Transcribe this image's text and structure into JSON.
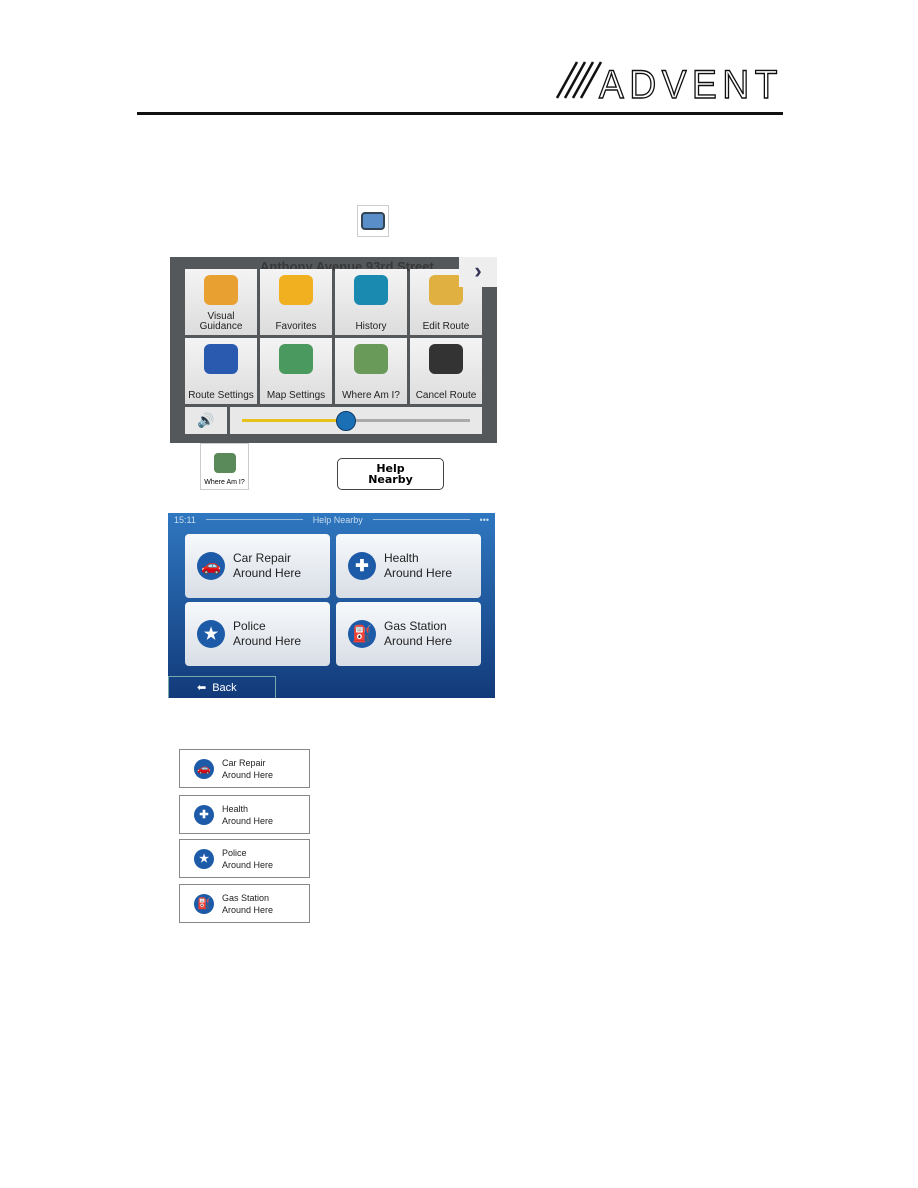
{
  "header": {
    "brand": "ADVENT"
  },
  "menu_screen": {
    "street": "Anthony Avenue 93rd Street",
    "items": [
      {
        "label": "Visual Guidance",
        "icon": "visual-guidance-icon",
        "color": "#e8a030"
      },
      {
        "label": "Favorites",
        "icon": "star-icon",
        "color": "#f0b020"
      },
      {
        "label": "History",
        "icon": "history-icon",
        "color": "#1a8ab0"
      },
      {
        "label": "Edit Route",
        "icon": "edit-route-icon",
        "color": "#e0b040"
      },
      {
        "label": "Route Settings",
        "icon": "route-settings-icon",
        "color": "#2a5ab0"
      },
      {
        "label": "Map Settings",
        "icon": "eye-icon",
        "color": "#4a9a60"
      },
      {
        "label": "Where Am I?",
        "icon": "where-am-i-icon",
        "color": "#6a9a5a"
      },
      {
        "label": "Cancel Route",
        "icon": "checkered-flag-icon",
        "color": "#333333"
      }
    ],
    "volume_percent": 45
  },
  "where_am_i_icon_label": "Where Am I?",
  "help_nearby_button": "Help Nearby",
  "help_screen": {
    "time": "15:11",
    "title": "Help Nearby",
    "back": "Back",
    "items": [
      {
        "line1": "Car Repair",
        "line2": "Around Here",
        "glyph": "🚗"
      },
      {
        "line1": "Health",
        "line2": "Around Here",
        "glyph": "✚"
      },
      {
        "line1": "Police",
        "line2": "Around Here",
        "glyph": "★"
      },
      {
        "line1": "Gas Station",
        "line2": "Around Here",
        "glyph": "⛽"
      }
    ]
  }
}
